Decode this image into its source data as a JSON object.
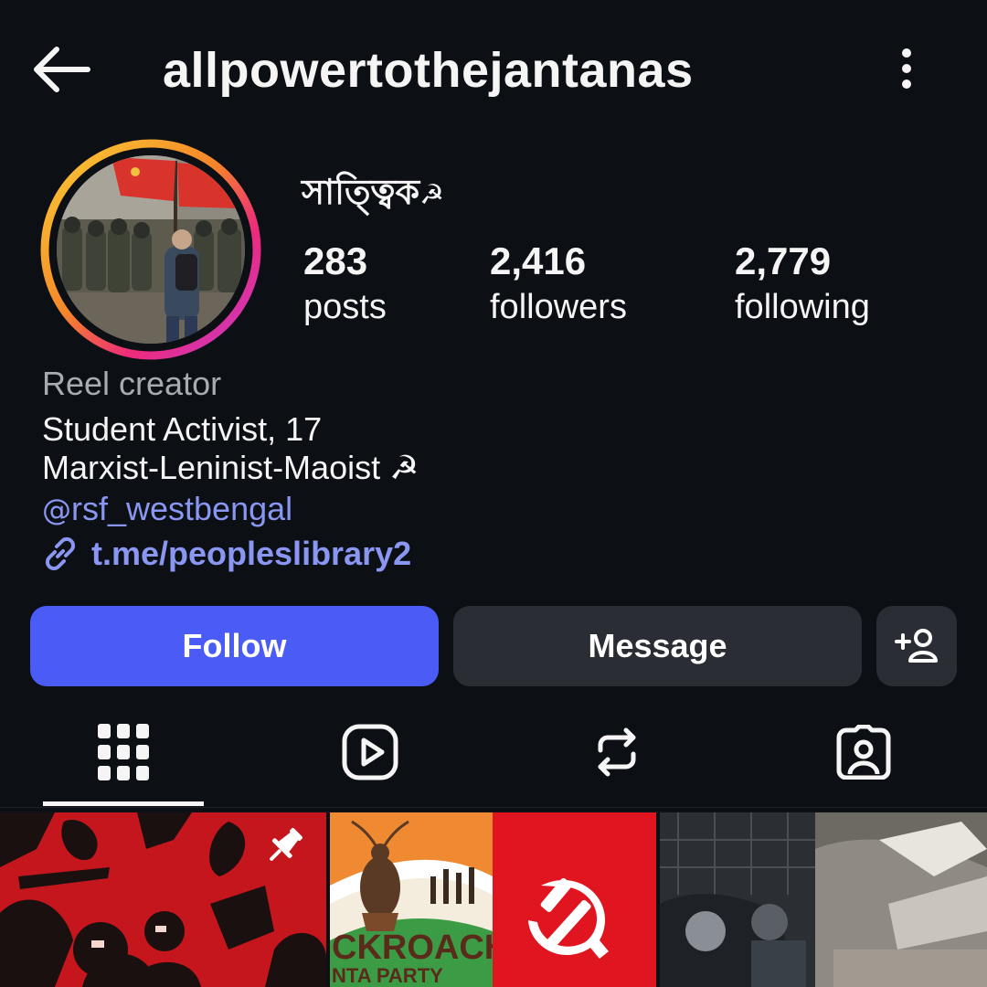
{
  "header": {
    "back_icon": "arrow-left-icon",
    "username": "allpowertothejantanas",
    "menu_icon": "more-vertical-icon"
  },
  "profile": {
    "display_name": "সাত্ত্বিক",
    "display_name_emoji": "☭",
    "avatar_ring_colors": [
      "#f9ce34",
      "#ee2a7b",
      "#c13cd1"
    ],
    "stats": {
      "posts": {
        "value": "283",
        "label": "posts"
      },
      "followers": {
        "value": "2,416",
        "label": "followers"
      },
      "following": {
        "value": "2,779",
        "label": "following"
      }
    }
  },
  "bio": {
    "category": "Reel creator",
    "line1": "Student Activist, 17",
    "line2": "Marxist-Leninist-Maoist ☭",
    "threads_glyph": "@",
    "threads_handle": "rsf_westbengal",
    "link": "t.me/peopleslibrary2"
  },
  "actions": {
    "follow_label": "Follow",
    "message_label": "Message",
    "add_icon": "person-add-icon"
  },
  "tabs": [
    {
      "name": "posts-grid",
      "icon": "grid-icon",
      "active": true
    },
    {
      "name": "reels",
      "icon": "reels-icon",
      "active": false
    },
    {
      "name": "reposts",
      "icon": "repost-icon",
      "active": false
    },
    {
      "name": "tagged",
      "icon": "tagged-person-icon",
      "active": false
    }
  ],
  "grid": {
    "thumb2_text_line1": "CKROACH",
    "thumb2_text_line2": "NTA PARTY"
  },
  "colors": {
    "background": "#0c0f14",
    "accent": "#4a5cf5",
    "link": "#8a97f2",
    "secondary_button": "#2a2d34"
  }
}
